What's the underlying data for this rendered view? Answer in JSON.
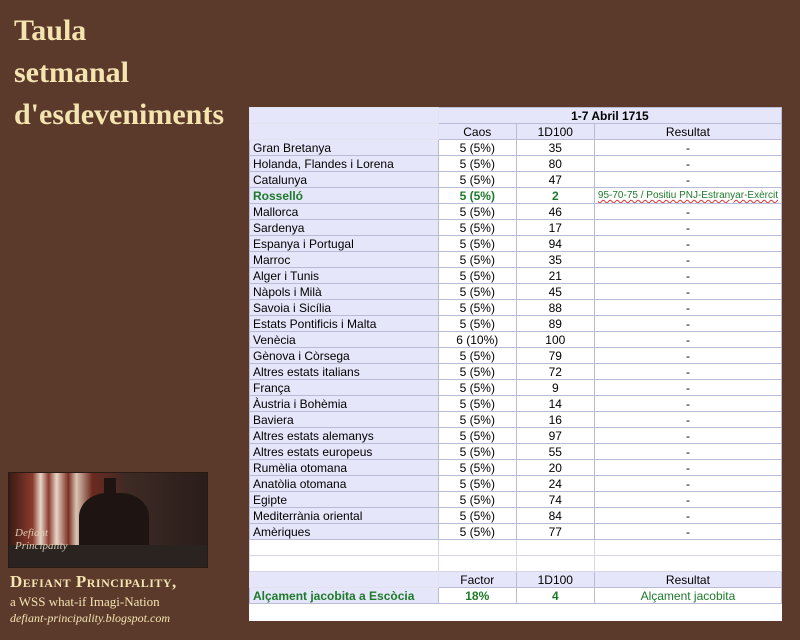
{
  "title_lines": [
    "Taula",
    "setmanal",
    "d'esdeveniments"
  ],
  "logo_caption": "Defiant Principality",
  "brand": {
    "name": "Defiant Principality,",
    "subtitle": "a WSS what-if Imagi-Nation",
    "url": "defiant-principality.blogspot.com"
  },
  "table": {
    "date_header": "1-7 Abril 1715",
    "columns": [
      "Caos",
      "1D100",
      "Resultat"
    ],
    "rows": [
      {
        "region": "Gran Bretanya",
        "caos": "5 (5%)",
        "roll": "35",
        "result": "-"
      },
      {
        "region": "Holanda, Flandes i Lorena",
        "caos": "5 (5%)",
        "roll": "80",
        "result": "-"
      },
      {
        "region": "Catalunya",
        "caos": "5 (5%)",
        "roll": "47",
        "result": "-"
      },
      {
        "region": "Rosselló",
        "caos": "5 (5%)",
        "roll": "2",
        "result": "95-70-75 / Positiu PNJ-Estranyar-Exèrcit",
        "highlight": true
      },
      {
        "region": "Mallorca",
        "caos": "5 (5%)",
        "roll": "46",
        "result": "-"
      },
      {
        "region": "Sardenya",
        "caos": "5 (5%)",
        "roll": "17",
        "result": "-"
      },
      {
        "region": "Espanya i Portugal",
        "caos": "5 (5%)",
        "roll": "94",
        "result": "-"
      },
      {
        "region": "Marroc",
        "caos": "5 (5%)",
        "roll": "35",
        "result": "-"
      },
      {
        "region": "Alger i Tunis",
        "caos": "5 (5%)",
        "roll": "21",
        "result": "-"
      },
      {
        "region": "Nàpols i Milà",
        "caos": "5 (5%)",
        "roll": "45",
        "result": "-"
      },
      {
        "region": "Savoia i Sicília",
        "caos": "5 (5%)",
        "roll": "88",
        "result": "-"
      },
      {
        "region": "Estats Pontificis i Malta",
        "caos": "5 (5%)",
        "roll": "89",
        "result": "-"
      },
      {
        "region": "Venècia",
        "caos": "6 (10%)",
        "roll": "100",
        "result": "-"
      },
      {
        "region": "Gènova i Còrsega",
        "caos": "5 (5%)",
        "roll": "79",
        "result": "-"
      },
      {
        "region": "Altres estats italians",
        "caos": "5 (5%)",
        "roll": "72",
        "result": "-"
      },
      {
        "region": "França",
        "caos": "5 (5%)",
        "roll": "9",
        "result": "-"
      },
      {
        "region": "Àustria i Bohèmia",
        "caos": "5 (5%)",
        "roll": "14",
        "result": "-"
      },
      {
        "region": "Baviera",
        "caos": "5 (5%)",
        "roll": "16",
        "result": "-"
      },
      {
        "region": "Altres estats alemanys",
        "caos": "5 (5%)",
        "roll": "97",
        "result": "-"
      },
      {
        "region": "Altres estats europeus",
        "caos": "5 (5%)",
        "roll": "55",
        "result": "-"
      },
      {
        "region": "Rumèlia otomana",
        "caos": "5 (5%)",
        "roll": "20",
        "result": "-"
      },
      {
        "region": "Anatòlia otomana",
        "caos": "5 (5%)",
        "roll": "24",
        "result": "-"
      },
      {
        "region": "Egipte",
        "caos": "5 (5%)",
        "roll": "74",
        "result": "-"
      },
      {
        "region": "Mediterrània oriental",
        "caos": "5 (5%)",
        "roll": "84",
        "result": "-"
      },
      {
        "region": "Amèriques",
        "caos": "5 (5%)",
        "roll": "77",
        "result": "-"
      }
    ],
    "footer_columns": [
      "Factor",
      "1D100",
      "Resultat"
    ],
    "footer_row": {
      "region": "Alçament jacobita a Escòcia",
      "factor": "18%",
      "roll": "4",
      "result": "Alçament jacobita"
    }
  }
}
